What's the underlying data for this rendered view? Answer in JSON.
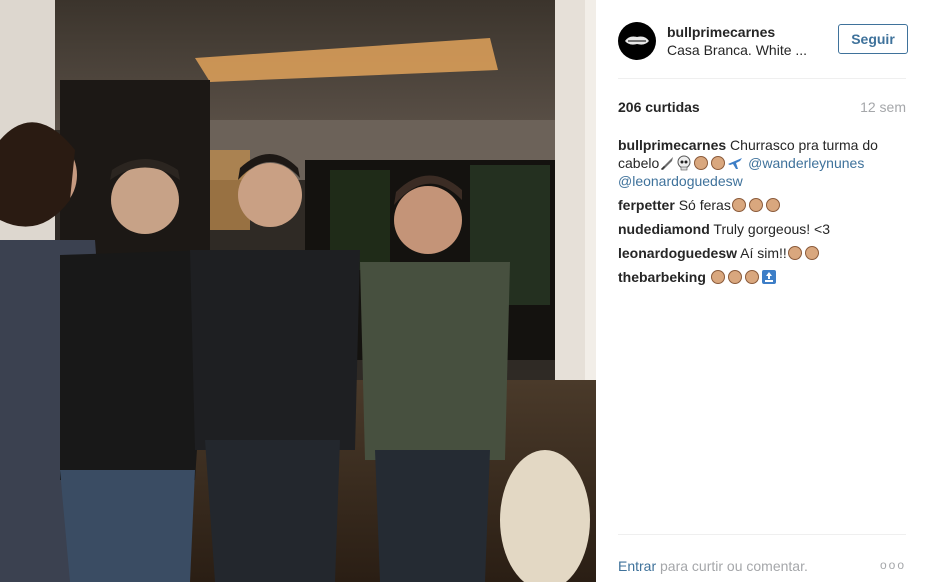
{
  "post": {
    "username": "bullprimecarnes",
    "location": "Casa Branca. White ...",
    "follow_label": "Seguir",
    "likes": "206 curtidas",
    "time_ago": "12 sem"
  },
  "comments": [
    {
      "user": "bullprimecarnes",
      "text_a": "Churrasco pra turma do cabelo",
      "mention1": "@wanderleynunes",
      "mention2": "@leonardoguedesw"
    },
    {
      "user": "ferpetter",
      "text": "Só feras"
    },
    {
      "user": "nudediamond",
      "text": "Truly gorgeous! <3"
    },
    {
      "user": "leonardoguedesw",
      "text": "Aí sim!!"
    },
    {
      "user": "thebarbeking",
      "text": ""
    }
  ],
  "footer": {
    "enter_label": "Entrar",
    "prompt_text": "para curtir ou comentar.",
    "more_label": "ooo"
  },
  "icons": [
    "avatar-logo-icon",
    "knife-icon",
    "skull-icon",
    "clap-icon",
    "airplane-icon",
    "top-arrow-icon",
    "more-options-icon"
  ]
}
